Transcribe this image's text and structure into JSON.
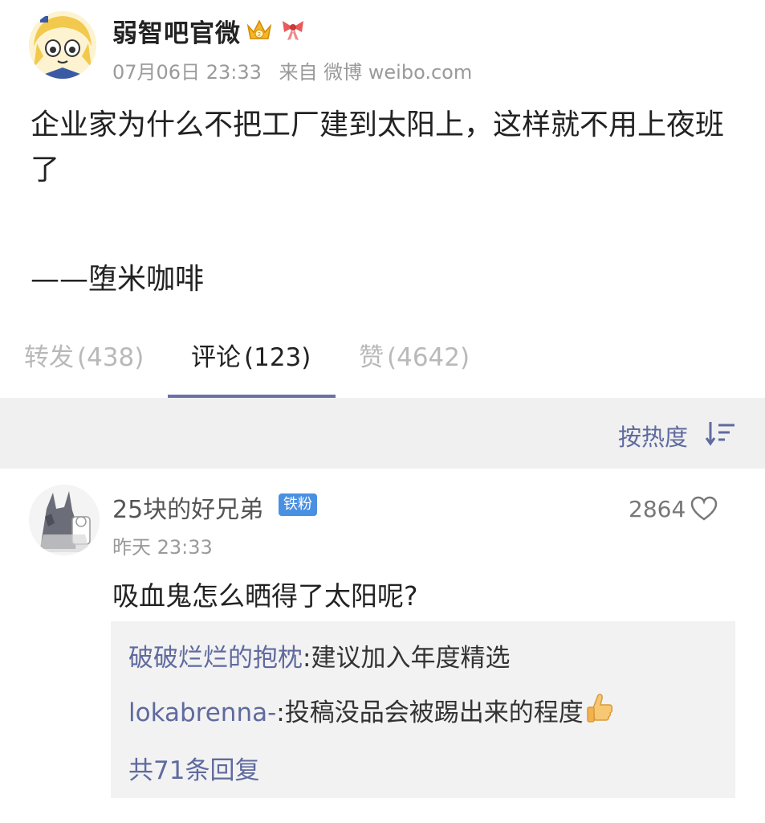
{
  "post": {
    "author": "弱智吧官微",
    "badges": [
      "crown-vip-icon",
      "bow-decoration-icon"
    ],
    "timestamp": "07月06日 23:33",
    "source": "来自 微博 weibo.com",
    "text": "企业家为什么不把工厂建到太阳上，这样就不用上夜班了",
    "signature": "——堕米咖啡"
  },
  "tabs": [
    {
      "label": "转发",
      "count": "(438)"
    },
    {
      "label": "评论",
      "count": "(123)",
      "active": true
    },
    {
      "label": "赞",
      "count": "(4642)"
    }
  ],
  "sort": {
    "label": "按热度",
    "icon": "sort-descending-icon"
  },
  "comment": {
    "user": "25块的好兄弟",
    "fan_badge": "铁粉",
    "time": "昨天 23:33",
    "likes": "2864",
    "text": "吸血鬼怎么晒得了太阳呢?",
    "replies": [
      {
        "user": "破破烂烂的抱枕",
        "text": ":建议加入年度精选"
      },
      {
        "user": "lokabrenna-",
        "text": ":投稿没品会被踢出来的程度",
        "emoji": "thumbs-up-icon"
      }
    ],
    "more_replies": "共71条回复"
  },
  "colors": {
    "link": "#5f6a9e",
    "tab_underline": "#6c6fa8",
    "fan_badge": "#4a90e2",
    "sortbar_bg": "#f0f0f0"
  }
}
